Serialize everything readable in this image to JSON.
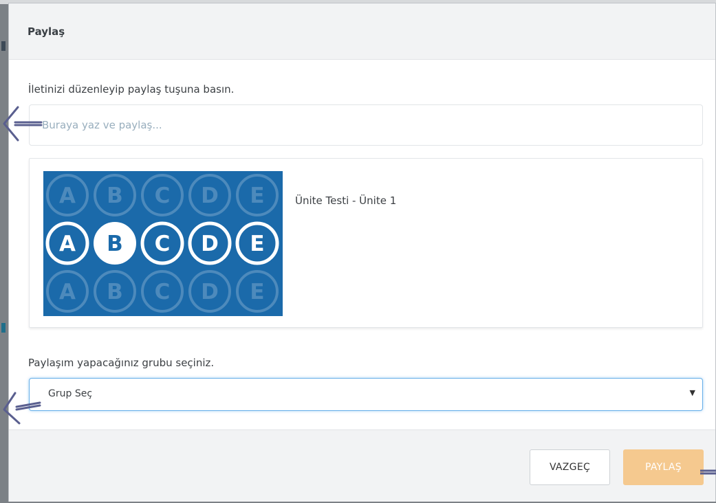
{
  "modal": {
    "title": "Paylaş",
    "instruction": "İletinizi düzenleyip paylaş tuşuna basın.",
    "message_placeholder": "Buraya yaz ve paylaş...",
    "share_card": {
      "title": "Ünite Testi - Ünite 1",
      "thumbnail_letters": [
        "A",
        "B",
        "C",
        "D",
        "E"
      ]
    },
    "group_label": "Paylaşım yapacağınız grubu seçiniz.",
    "group_select": {
      "selected": "Grup Seç",
      "caret": "▼"
    },
    "buttons": {
      "cancel": "VAZGEÇ",
      "share": "PAYLAŞ"
    }
  },
  "colors": {
    "thumbnail_bg": "#1b6aaa",
    "share_button": "#f5c98f",
    "focus_border": "#66afe9",
    "annotation_arrow": "#5a5f8f"
  }
}
